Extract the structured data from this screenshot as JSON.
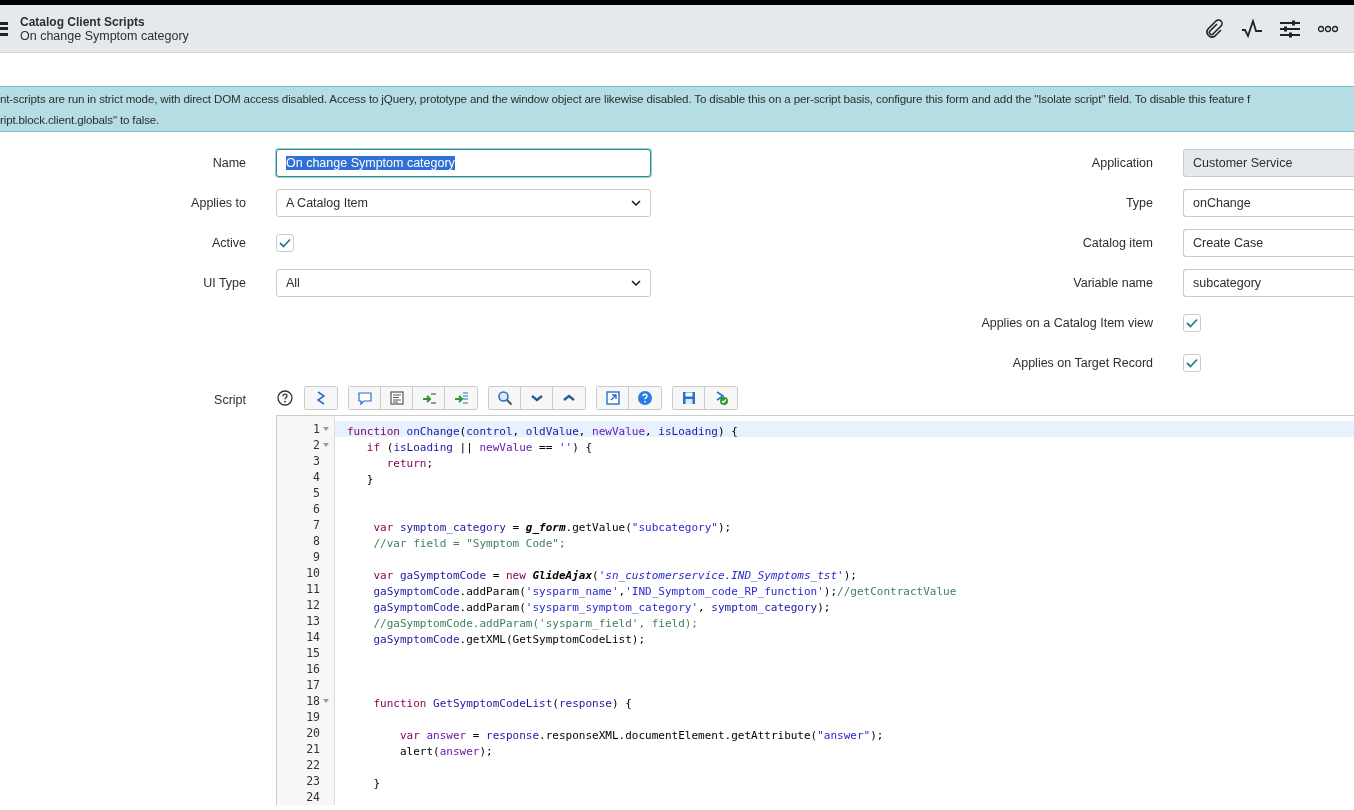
{
  "header": {
    "title": "Catalog Client Scripts",
    "subtitle": "On change Symptom category"
  },
  "banner": {
    "lines": [
      "nt-scripts are run in strict mode, with direct DOM access disabled. Access to jQuery, prototype and the window object are likewise disabled. To disable this on a per-script basis, configure this form and add the \"Isolate script\" field. To disable this feature f",
      "ript.block.client.globals\" to false."
    ]
  },
  "left_fields": [
    {
      "label": "Name",
      "kind": "input",
      "value": "On change Symptom category",
      "text_selected": true
    },
    {
      "label": "Applies to",
      "kind": "select",
      "value": "A Catalog Item"
    },
    {
      "label": "Active",
      "kind": "checkbox",
      "checked": true
    },
    {
      "label": "UI Type",
      "kind": "select",
      "value": "All"
    }
  ],
  "right_fields": [
    {
      "label": "Application",
      "kind": "readonly",
      "value": "Customer Service"
    },
    {
      "label": "Type",
      "kind": "select",
      "value": "onChange"
    },
    {
      "label": "Catalog item",
      "kind": "input",
      "value": "Create Case"
    },
    {
      "label": "Variable name",
      "kind": "select",
      "value": "subcategory"
    },
    {
      "label": "Applies on a Catalog Item view",
      "kind": "checkbox",
      "checked": true
    },
    {
      "label": "Applies on Target Record",
      "kind": "checkbox",
      "checked": true
    }
  ],
  "script": {
    "label": "Script",
    "lines": [
      {
        "num": "1",
        "fold": true,
        "active": true,
        "tokens": [
          {
            "kind": "keyword",
            "text": "function "
          },
          {
            "kind": "name",
            "text": "onChange"
          },
          {
            "kind": "plain",
            "text": "("
          },
          {
            "kind": "name",
            "text": "control"
          },
          {
            "kind": "plain",
            "text": ", "
          },
          {
            "kind": "name",
            "text": "oldValue"
          },
          {
            "kind": "plain",
            "text": ", "
          },
          {
            "kind": "param",
            "text": "newValue"
          },
          {
            "kind": "plain",
            "text": ", "
          },
          {
            "kind": "name",
            "text": "isLoading"
          },
          {
            "kind": "plain",
            "text": ") {"
          }
        ]
      },
      {
        "num": "2",
        "fold": true,
        "active": false,
        "tokens": [
          {
            "kind": "keyword",
            "text": "   if"
          },
          {
            "kind": "plain",
            "text": " ("
          },
          {
            "kind": "name",
            "text": "isLoading"
          },
          {
            "kind": "plain",
            "text": " || "
          },
          {
            "kind": "param",
            "text": "newValue"
          },
          {
            "kind": "plain",
            "text": " == "
          },
          {
            "kind": "string",
            "text": "''"
          },
          {
            "kind": "plain",
            "text": ") {"
          }
        ]
      },
      {
        "num": "3",
        "fold": false,
        "active": false,
        "tokens": [
          {
            "kind": "keyword",
            "text": "      return"
          },
          {
            "kind": "plain",
            "text": ";"
          }
        ]
      },
      {
        "num": "4",
        "fold": false,
        "active": false,
        "tokens": [
          {
            "kind": "plain",
            "text": "   }"
          }
        ]
      },
      {
        "num": "5",
        "fold": false,
        "active": false
      },
      {
        "num": "6",
        "fold": false,
        "active": false
      },
      {
        "num": "7",
        "fold": false,
        "active": false,
        "tokens": [
          {
            "kind": "keyword",
            "text": "    var "
          },
          {
            "kind": "name",
            "text": "symptom_category"
          },
          {
            "kind": "plain",
            "text": " = "
          },
          {
            "kind": "global",
            "text": "g_form"
          },
          {
            "kind": "plain",
            "text": ".getValue("
          },
          {
            "kind": "string",
            "text": "\"subcategory\""
          },
          {
            "kind": "plain",
            "text": ");"
          }
        ]
      },
      {
        "num": "8",
        "fold": false,
        "active": false,
        "tokens": [
          {
            "kind": "comment",
            "text": "    //var field = \"Symptom Code\";"
          }
        ]
      },
      {
        "num": "9",
        "fold": false,
        "active": false
      },
      {
        "num": "10",
        "fold": false,
        "active": false,
        "tokens": [
          {
            "kind": "keyword",
            "text": "    var "
          },
          {
            "kind": "name",
            "text": "gaSymptomCode"
          },
          {
            "kind": "plain",
            "text": " = "
          },
          {
            "kind": "keyword",
            "text": "new "
          },
          {
            "kind": "global",
            "text": "GlideAjax"
          },
          {
            "kind": "plain",
            "text": "("
          },
          {
            "kind": "string_italic",
            "text": "'sn_customerservice.IND_Symptoms_tst'"
          },
          {
            "kind": "plain",
            "text": ");"
          }
        ]
      },
      {
        "num": "11",
        "fold": false,
        "active": false,
        "tokens": [
          {
            "kind": "name",
            "text": "    gaSymptomCode"
          },
          {
            "kind": "plain",
            "text": ".addParam("
          },
          {
            "kind": "string",
            "text": "'sysparm_name'"
          },
          {
            "kind": "plain",
            "text": ","
          },
          {
            "kind": "string",
            "text": "'IND_Symptom_code_RP_function'"
          },
          {
            "kind": "plain",
            "text": ");"
          },
          {
            "kind": "comment",
            "text": "//getContractValue"
          }
        ]
      },
      {
        "num": "12",
        "fold": false,
        "active": false,
        "tokens": [
          {
            "kind": "name",
            "text": "    gaSymptomCode"
          },
          {
            "kind": "plain",
            "text": ".addParam("
          },
          {
            "kind": "string",
            "text": "'sysparm_symptom_category'"
          },
          {
            "kind": "plain",
            "text": ", "
          },
          {
            "kind": "name",
            "text": "symptom_category"
          },
          {
            "kind": "plain",
            "text": ");"
          }
        ]
      },
      {
        "num": "13",
        "fold": false,
        "active": false,
        "tokens": [
          {
            "kind": "comment",
            "text": "    //gaSymptomCode.addParam('sysparm_field', field);"
          }
        ]
      },
      {
        "num": "14",
        "fold": false,
        "active": false,
        "tokens": [
          {
            "kind": "name",
            "text": "    gaSymptomCode"
          },
          {
            "kind": "plain",
            "text": ".getXML(GetSymptomCodeList);"
          }
        ]
      },
      {
        "num": "15",
        "fold": false,
        "active": false
      },
      {
        "num": "16",
        "fold": false,
        "active": false
      },
      {
        "num": "17",
        "fold": false,
        "active": false
      },
      {
        "num": "18",
        "fold": true,
        "active": false,
        "tokens": [
          {
            "kind": "keyword",
            "text": "    function "
          },
          {
            "kind": "name",
            "text": "GetSymptomCodeList"
          },
          {
            "kind": "plain",
            "text": "("
          },
          {
            "kind": "name",
            "text": "response"
          },
          {
            "kind": "plain",
            "text": ") {"
          }
        ]
      },
      {
        "num": "19",
        "fold": false,
        "active": false
      },
      {
        "num": "20",
        "fold": false,
        "active": false,
        "tokens": [
          {
            "kind": "keyword",
            "text": "        var "
          },
          {
            "kind": "param",
            "text": "answer"
          },
          {
            "kind": "plain",
            "text": " = "
          },
          {
            "kind": "name",
            "text": "response"
          },
          {
            "kind": "plain",
            "text": ".responseXML.documentElement.getAttribute("
          },
          {
            "kind": "string",
            "text": "\"answer\""
          },
          {
            "kind": "plain",
            "text": ");"
          }
        ]
      },
      {
        "num": "21",
        "fold": false,
        "active": false,
        "tokens": [
          {
            "kind": "plain",
            "text": "        alert("
          },
          {
            "kind": "param",
            "text": "answer"
          },
          {
            "kind": "plain",
            "text": ");"
          }
        ]
      },
      {
        "num": "22",
        "fold": false,
        "active": false
      },
      {
        "num": "23",
        "fold": false,
        "active": false,
        "tokens": [
          {
            "kind": "plain",
            "text": "    }"
          }
        ]
      },
      {
        "num": "24",
        "fold": false,
        "active": false
      }
    ]
  }
}
